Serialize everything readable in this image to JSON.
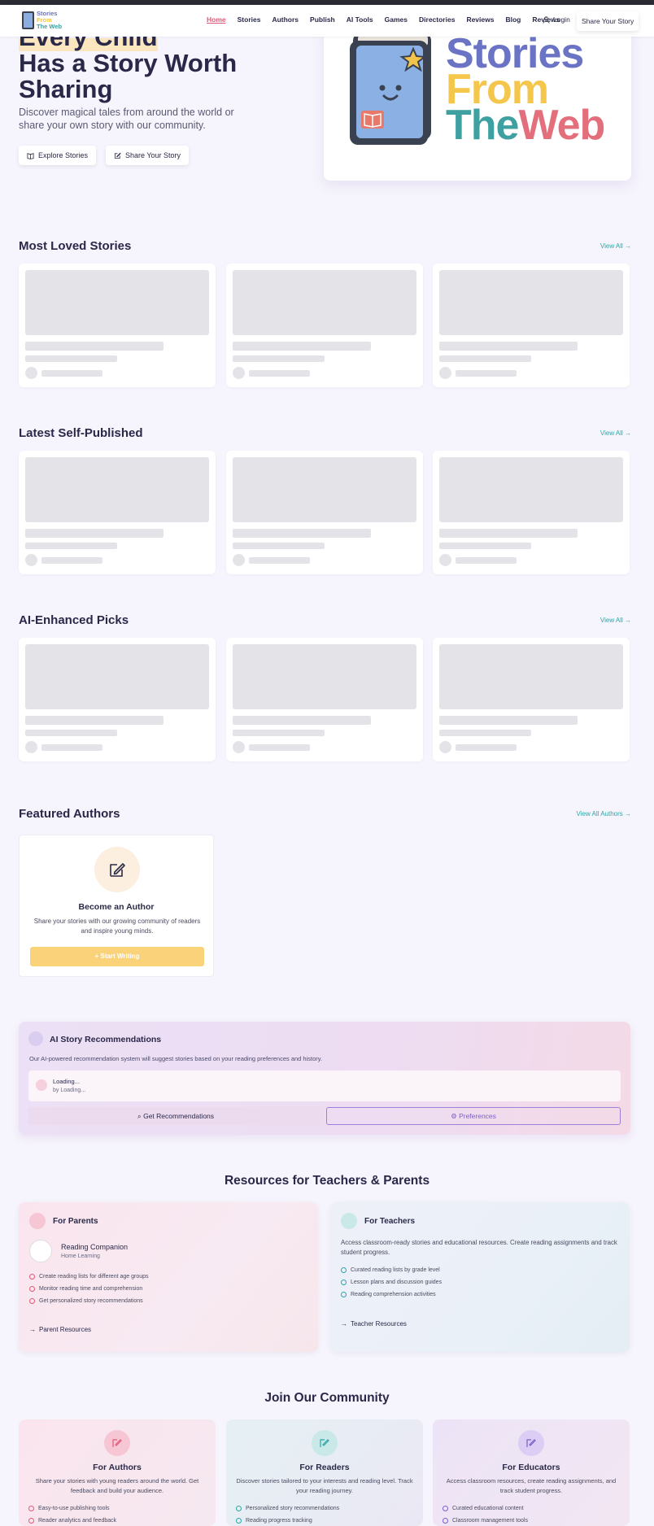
{
  "nav": {
    "logo_lines": [
      "Stories",
      "From",
      "The Web"
    ],
    "links": [
      "Home",
      "Stories",
      "Authors",
      "Publish",
      "AI Tools",
      "Games",
      "Directories",
      "Reviews",
      "Blog",
      "Reviews"
    ],
    "login": "Login",
    "share": "Share Your Story"
  },
  "hero": {
    "title_line1": "Every Child",
    "title_line2": "Has a Story Worth",
    "title_line3": "Sharing",
    "subtitle": "Discover magical tales from around the world or share your own story with our community.",
    "btn_explore": "Explore Stories",
    "btn_share": "Share Your Story",
    "logo_line1": "Stories",
    "logo_line2": "From",
    "logo_line3a": "The",
    "logo_line3b": "Web"
  },
  "sections": {
    "most_loved": "Most Loved Stories",
    "latest": "Latest Self-Published",
    "ai_picks": "AI-Enhanced Picks",
    "view_all": "View All →",
    "featured_authors": "Featured Authors",
    "view_all_authors": "View All Authors →"
  },
  "author_card": {
    "title": "Become an Author",
    "desc": "Share your stories with our growing community of readers and inspire young minds.",
    "button": "+ Start Writing"
  },
  "ai": {
    "title": "AI Story Recommendations",
    "desc": "Our AI-powered recommendation system will suggest stories based on your reading preferences and history.",
    "loading": "Loading...",
    "by_loading": "by Loading...",
    "get_btn": "Get Recommendations",
    "pref_btn": "Preferences"
  },
  "resources": {
    "title": "Resources for Teachers & Parents",
    "parents": {
      "heading": "For Parents",
      "companion_title": "Reading Companion",
      "companion_sub": "Home Learning",
      "items": [
        "Create reading lists for different age groups",
        "Monitor reading time and comprehension",
        "Get personalized story recommendations"
      ],
      "link": "Parent Resources"
    },
    "teachers": {
      "heading": "For Teachers",
      "desc": "Access classroom-ready stories and educational resources. Create reading assignments and track student progress.",
      "items": [
        "Curated reading lists by grade level",
        "Lesson plans and discussion guides",
        "Reading comprehension activities"
      ],
      "link": "Teacher Resources"
    }
  },
  "community": {
    "title": "Join Our Community",
    "authors": {
      "title": "For Authors",
      "desc": "Share your stories with young readers around the world. Get feedback and build your audience.",
      "items": [
        "Easy-to-use publishing tools",
        "Reader analytics and feedback"
      ]
    },
    "readers": {
      "title": "For Readers",
      "desc": "Discover stories tailored to your interests and reading level. Track your reading journey.",
      "items": [
        "Personalized story recommendations",
        "Reading progress tracking"
      ]
    },
    "educators": {
      "title": "For Educators",
      "desc": "Access classroom resources, create reading assignments, and track student progress.",
      "items": [
        "Curated educational content",
        "Classroom management tools"
      ]
    }
  },
  "colors": {
    "accent_teal": "#2fa6a6",
    "accent_pink": "#e15a78",
    "accent_yellow": "#fad27a",
    "accent_purple": "#7b60c8"
  }
}
